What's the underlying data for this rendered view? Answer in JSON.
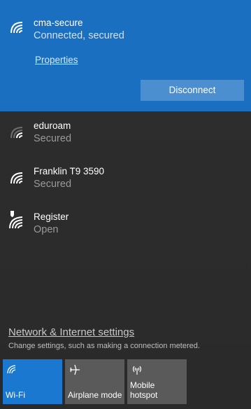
{
  "connected_network": {
    "name": "cma-secure",
    "status": "Connected, secured",
    "properties_label": "Properties",
    "disconnect_label": "Disconnect",
    "icon": "wifi-signal-icon"
  },
  "networks": [
    {
      "name": "eduroam",
      "status": "Secured",
      "icon": "wifi-weak-signal-icon"
    },
    {
      "name": "Franklin T9 3590",
      "status": "Secured",
      "icon": "wifi-signal-icon"
    },
    {
      "name": "Register",
      "status": "Open",
      "icon": "wifi-open-shield-icon"
    }
  ],
  "settings": {
    "link_label": "Network & Internet settings",
    "description": "Change settings, such as making a connection metered."
  },
  "quick_actions": [
    {
      "label": "Wi-Fi",
      "icon": "wifi-icon",
      "active": true
    },
    {
      "label": "Airplane mode",
      "icon": "airplane-icon",
      "active": false
    },
    {
      "label": "Mobile hotspot",
      "icon": "hotspot-icon",
      "active": false
    }
  ],
  "colors": {
    "accent": "#1a6fc0",
    "tile_active": "#1a78d0",
    "tile_inactive": "#5a5a5a",
    "background": "#2b2b2b"
  }
}
